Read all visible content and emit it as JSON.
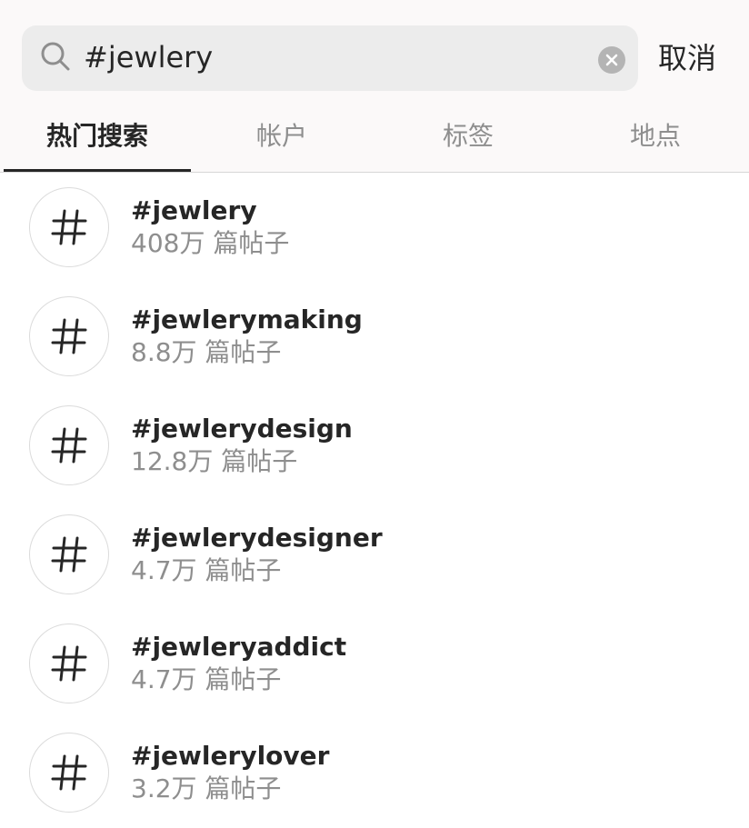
{
  "search": {
    "query": "#jewlery",
    "cancel_label": "取消"
  },
  "tabs": [
    {
      "label": "热门搜索",
      "active": true
    },
    {
      "label": "帐户",
      "active": false
    },
    {
      "label": "标签",
      "active": false
    },
    {
      "label": "地点",
      "active": false
    }
  ],
  "results": [
    {
      "name": "#jewlery",
      "count": "408万 篇帖子"
    },
    {
      "name": "#jewlerymaking",
      "count": "8.8万 篇帖子"
    },
    {
      "name": "#jewlerydesign",
      "count": "12.8万 篇帖子"
    },
    {
      "name": "#jewlerydesigner",
      "count": "4.7万 篇帖子"
    },
    {
      "name": "#jewleryaddict",
      "count": "4.7万 篇帖子"
    },
    {
      "name": "#jewlerylover",
      "count": "3.2万 篇帖子"
    }
  ],
  "colors": {
    "background": "#ffffff",
    "header_background": "#fbf9f9",
    "search_field": "#ececec",
    "primary_text": "#262626",
    "secondary_text": "#8e8e8e"
  },
  "icons": {
    "search": "search-icon",
    "clear": "clear-icon",
    "hashtag": "hashtag-icon"
  }
}
